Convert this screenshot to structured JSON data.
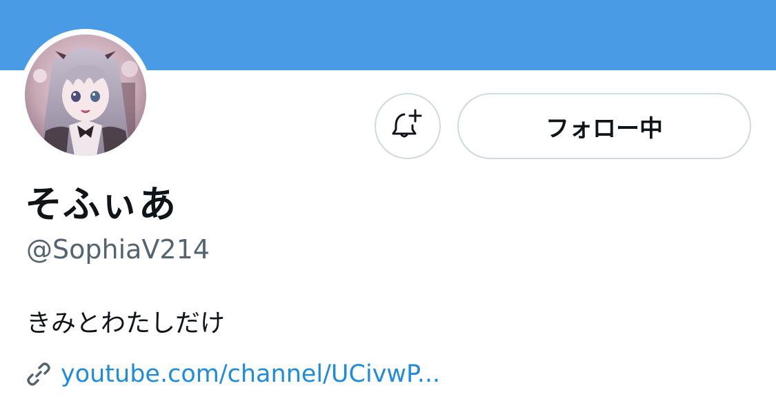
{
  "profile": {
    "display_name": "そふぃあ",
    "handle": "@SophiaV214",
    "bio": "きみとわたしだけ",
    "link": "youtube.com/channel/UCivwP...",
    "avatar_icon": "avatar-image"
  },
  "actions": {
    "notify_icon": "bell-plus-icon",
    "follow_label": "フォロー中"
  },
  "colors": {
    "banner": "#4a9be5",
    "link": "#1d8ce0",
    "handle": "#536471",
    "text": "#0f1419",
    "border": "#cfd9de"
  },
  "icons": {
    "link": "link-icon"
  }
}
